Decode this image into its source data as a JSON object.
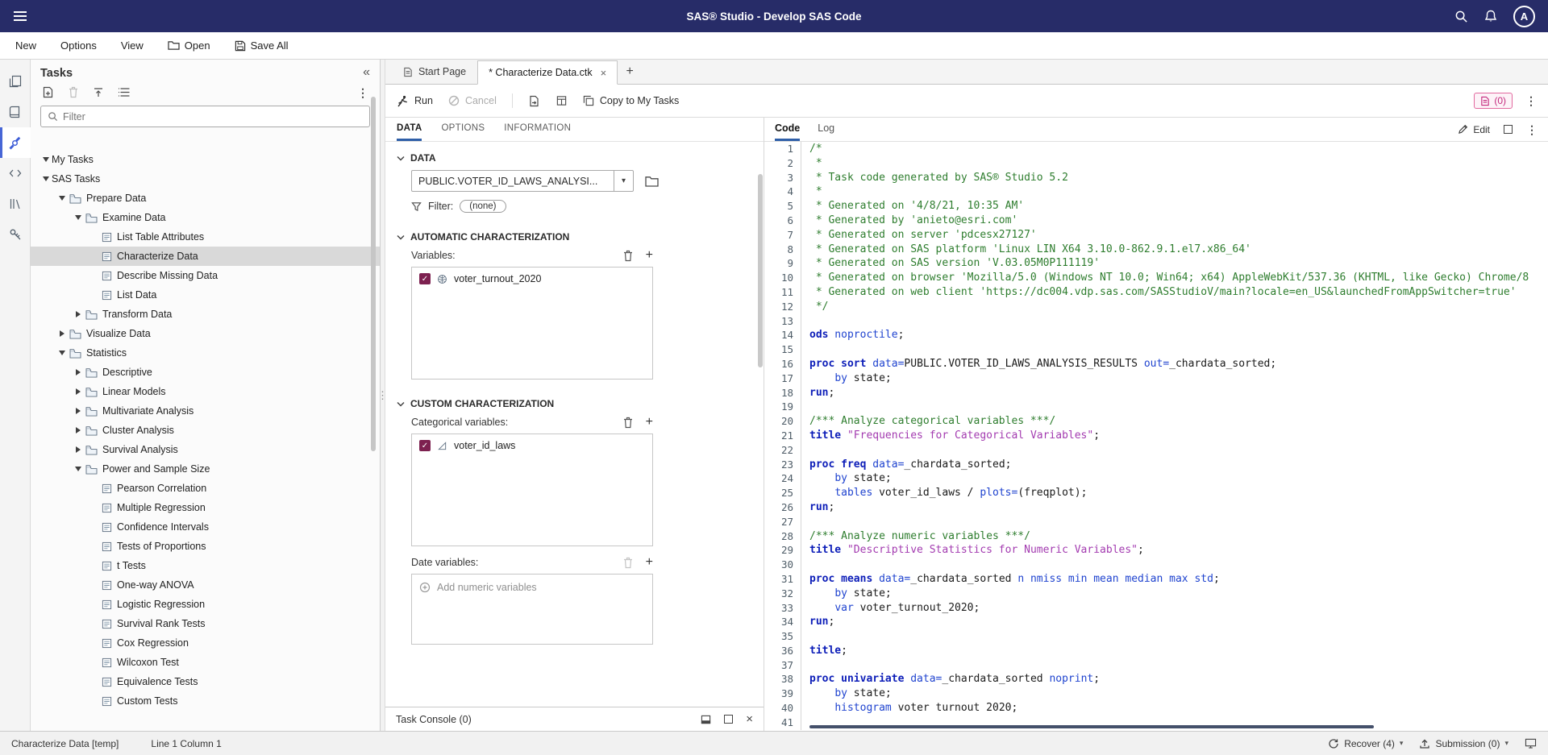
{
  "app": {
    "title": "SAS® Studio - Develop SAS Code",
    "avatar_letter": "A"
  },
  "icons": {
    "kebab": "⋮",
    "collapse_panel": "«",
    "plus": "+",
    "close": "×",
    "dropdown_caret": "▾",
    "checkmark": "✓",
    "splitter_handle": "⋮"
  },
  "menubar": {
    "new": "New",
    "options": "Options",
    "view": "View",
    "open": "Open",
    "save_all": "Save All"
  },
  "tasks_panel": {
    "title": "Tasks",
    "filter_placeholder": "Filter",
    "tree": [
      {
        "label": "My Tasks",
        "level": 0,
        "kind": "category",
        "state": "expanded"
      },
      {
        "label": "SAS Tasks",
        "level": 0,
        "kind": "category",
        "state": "expanded"
      },
      {
        "label": "Prepare Data",
        "level": 1,
        "kind": "folder",
        "state": "expanded"
      },
      {
        "label": "Examine Data",
        "level": 2,
        "kind": "folder",
        "state": "expanded"
      },
      {
        "label": "List Table Attributes",
        "level": 3,
        "kind": "task"
      },
      {
        "label": "Characterize Data",
        "level": 3,
        "kind": "task",
        "selected": true
      },
      {
        "label": "Describe Missing Data",
        "level": 3,
        "kind": "task"
      },
      {
        "label": "List Data",
        "level": 3,
        "kind": "task"
      },
      {
        "label": "Transform Data",
        "level": 2,
        "kind": "folder",
        "state": "collapsed"
      },
      {
        "label": "Visualize Data",
        "level": 1,
        "kind": "folder",
        "state": "collapsed"
      },
      {
        "label": "Statistics",
        "level": 1,
        "kind": "folder",
        "state": "expanded"
      },
      {
        "label": "Descriptive",
        "level": 2,
        "kind": "folder",
        "state": "collapsed"
      },
      {
        "label": "Linear Models",
        "level": 2,
        "kind": "folder",
        "state": "collapsed"
      },
      {
        "label": "Multivariate Analysis",
        "level": 2,
        "kind": "folder",
        "state": "collapsed"
      },
      {
        "label": "Cluster Analysis",
        "level": 2,
        "kind": "folder",
        "state": "collapsed"
      },
      {
        "label": "Survival Analysis",
        "level": 2,
        "kind": "folder",
        "state": "collapsed"
      },
      {
        "label": "Power and Sample Size",
        "level": 2,
        "kind": "folder",
        "state": "expanded"
      },
      {
        "label": "Pearson Correlation",
        "level": 3,
        "kind": "task"
      },
      {
        "label": "Multiple Regression",
        "level": 3,
        "kind": "task"
      },
      {
        "label": "Confidence Intervals",
        "level": 3,
        "kind": "task"
      },
      {
        "label": "Tests of Proportions",
        "level": 3,
        "kind": "task"
      },
      {
        "label": "t Tests",
        "level": 3,
        "kind": "task"
      },
      {
        "label": "One-way ANOVA",
        "level": 3,
        "kind": "task"
      },
      {
        "label": "Logistic Regression",
        "level": 3,
        "kind": "task"
      },
      {
        "label": "Survival Rank Tests",
        "level": 3,
        "kind": "task"
      },
      {
        "label": "Cox Regression",
        "level": 3,
        "kind": "task"
      },
      {
        "label": "Wilcoxon Test",
        "level": 3,
        "kind": "task"
      },
      {
        "label": "Equivalence Tests",
        "level": 3,
        "kind": "task"
      },
      {
        "label": "Custom Tests",
        "level": 3,
        "kind": "task"
      }
    ]
  },
  "editor_tabs": {
    "tabs": [
      {
        "label": "Start Page"
      },
      {
        "label": "* Characterize Data.ctk"
      }
    ]
  },
  "toolbar": {
    "run": "Run",
    "cancel": "Cancel",
    "copy_to_my_tasks": "Copy to My Tasks",
    "message_badge": "(0)"
  },
  "task_pane": {
    "tabs": {
      "data": "DATA",
      "options": "OPTIONS",
      "information": "INFORMATION"
    },
    "data_section": {
      "title": "DATA",
      "table": "PUBLIC.VOTER_ID_LAWS_ANALYSI...",
      "filter_label": "Filter:",
      "filter_value": "(none)"
    },
    "automatic_section": {
      "title": "AUTOMATIC CHARACTERIZATION",
      "variables_label": "Variables:",
      "variables": [
        {
          "name": "voter_turnout_2020",
          "checked": true,
          "type": "numeric"
        }
      ]
    },
    "custom_section": {
      "title": "CUSTOM CHARACTERIZATION",
      "categorical_label": "Categorical variables:",
      "categorical_variables": [
        {
          "name": "voter_id_laws",
          "checked": true,
          "type": "categorical"
        }
      ],
      "date_label": "Date variables:",
      "date_placeholder": "Add numeric variables"
    },
    "console_label": "Task Console (0)"
  },
  "code_pane": {
    "tabs": {
      "code": "Code",
      "log": "Log"
    },
    "edit_label": "Edit",
    "lines": [
      [
        [
          "c",
          "/*"
        ]
      ],
      [
        [
          "c",
          " *"
        ]
      ],
      [
        [
          "c",
          " * Task code generated by SAS® Studio 5.2"
        ]
      ],
      [
        [
          "c",
          " *"
        ]
      ],
      [
        [
          "c",
          " * Generated on '4/8/21, 10:35 AM'"
        ]
      ],
      [
        [
          "c",
          " * Generated by 'anieto@esri.com'"
        ]
      ],
      [
        [
          "c",
          " * Generated on server 'pdcesx27127'"
        ]
      ],
      [
        [
          "c",
          " * Generated on SAS platform 'Linux LIN X64 3.10.0-862.9.1.el7.x86_64'"
        ]
      ],
      [
        [
          "c",
          " * Generated on SAS version 'V.03.05M0P111119'"
        ]
      ],
      [
        [
          "c",
          " * Generated on browser 'Mozilla/5.0 (Windows NT 10.0; Win64; x64) AppleWebKit/537.36 (KHTML, like Gecko) Chrome/8"
        ]
      ],
      [
        [
          "c",
          " * Generated on web client 'https://dc004.vdp.sas.com/SASStudioV/main?locale=en_US&launchedFromAppSwitcher=true'"
        ]
      ],
      [
        [
          "c",
          " */"
        ]
      ],
      [],
      [
        [
          "k",
          "ods"
        ],
        [
          "b",
          " noproctile"
        ],
        [
          "p",
          ";"
        ]
      ],
      [],
      [
        [
          "k",
          "proc sort"
        ],
        [
          "p",
          " "
        ],
        [
          "b",
          "data="
        ],
        [
          "p",
          "PUBLIC.VOTER_ID_LAWS_ANALYSIS_RESULTS "
        ],
        [
          "b",
          "out="
        ],
        [
          "p",
          "_chardata_sorted;"
        ]
      ],
      [
        [
          "p",
          "    "
        ],
        [
          "b",
          "by"
        ],
        [
          "p",
          " state;"
        ]
      ],
      [
        [
          "k",
          "run"
        ],
        [
          "p",
          ";"
        ]
      ],
      [],
      [
        [
          "c",
          "/*** Analyze categorical variables ***/"
        ]
      ],
      [
        [
          "k",
          "title"
        ],
        [
          "p",
          " "
        ],
        [
          "s",
          "\"Frequencies for Categorical Variables\""
        ],
        [
          "p",
          ";"
        ]
      ],
      [],
      [
        [
          "k",
          "proc freq"
        ],
        [
          "p",
          " "
        ],
        [
          "b",
          "data="
        ],
        [
          "p",
          "_chardata_sorted;"
        ]
      ],
      [
        [
          "p",
          "    "
        ],
        [
          "b",
          "by"
        ],
        [
          "p",
          " state;"
        ]
      ],
      [
        [
          "p",
          "    "
        ],
        [
          "b",
          "tables"
        ],
        [
          "p",
          " voter_id_laws / "
        ],
        [
          "b",
          "plots="
        ],
        [
          "p",
          "(freqplot);"
        ]
      ],
      [
        [
          "k",
          "run"
        ],
        [
          "p",
          ";"
        ]
      ],
      [],
      [
        [
          "c",
          "/*** Analyze numeric variables ***/"
        ]
      ],
      [
        [
          "k",
          "title"
        ],
        [
          "p",
          " "
        ],
        [
          "s",
          "\"Descriptive Statistics for Numeric Variables\""
        ],
        [
          "p",
          ";"
        ]
      ],
      [],
      [
        [
          "k",
          "proc means"
        ],
        [
          "p",
          " "
        ],
        [
          "b",
          "data="
        ],
        [
          "p",
          "_chardata_sorted "
        ],
        [
          "b",
          "n nmiss min mean median max std"
        ],
        [
          "p",
          ";"
        ]
      ],
      [
        [
          "p",
          "    "
        ],
        [
          "b",
          "by"
        ],
        [
          "p",
          " state;"
        ]
      ],
      [
        [
          "p",
          "    "
        ],
        [
          "b",
          "var"
        ],
        [
          "p",
          " voter_turnout_2020;"
        ]
      ],
      [
        [
          "k",
          "run"
        ],
        [
          "p",
          ";"
        ]
      ],
      [],
      [
        [
          "k",
          "title"
        ],
        [
          "p",
          ";"
        ]
      ],
      [],
      [
        [
          "k",
          "proc univariate"
        ],
        [
          "p",
          " "
        ],
        [
          "b",
          "data="
        ],
        [
          "p",
          "_chardata_sorted "
        ],
        [
          "b",
          "noprint"
        ],
        [
          "p",
          ";"
        ]
      ],
      [
        [
          "p",
          "    "
        ],
        [
          "b",
          "by"
        ],
        [
          "p",
          " state;"
        ]
      ],
      [
        [
          "p",
          "    "
        ],
        [
          "b",
          "histogram"
        ],
        [
          "p",
          " voter turnout 2020;"
        ]
      ],
      []
    ]
  },
  "status_bar": {
    "document": "Characterize Data [temp]",
    "position": "Line 1 Column 1",
    "recover": "Recover (4)",
    "submission": "Submission (0)"
  }
}
